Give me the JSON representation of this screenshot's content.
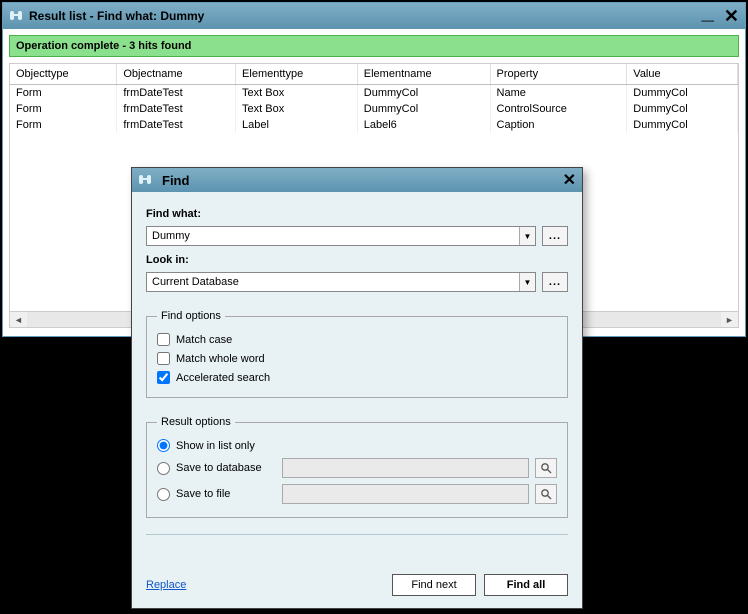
{
  "main_window": {
    "title": "Result list - Find what: Dummy",
    "status": "Operation complete - 3 hits found",
    "columns": [
      "Objecttype",
      "Objectname",
      "Elementtype",
      "Elementname",
      "Property",
      "Value"
    ],
    "rows": [
      {
        "objecttype": "Form",
        "objectname": "frmDateTest",
        "elementtype": "Text Box",
        "elementname": "DummyCol",
        "property": "Name",
        "value": "DummyCol"
      },
      {
        "objecttype": "Form",
        "objectname": "frmDateTest",
        "elementtype": "Text Box",
        "elementname": "DummyCol",
        "property": "ControlSource",
        "value": "DummyCol"
      },
      {
        "objecttype": "Form",
        "objectname": "frmDateTest",
        "elementtype": "Label",
        "elementname": "Label6",
        "property": "Caption",
        "value": "DummyCol"
      }
    ]
  },
  "find_dialog": {
    "title": "Find",
    "find_what_label": "Find what:",
    "find_what_value": "Dummy",
    "look_in_label": "Look in:",
    "look_in_value": "Current Database",
    "browse_label": "...",
    "find_options": {
      "legend": "Find options",
      "match_case": {
        "label": "Match case",
        "checked": false
      },
      "match_whole_word": {
        "label": "Match whole word",
        "checked": false
      },
      "accelerated": {
        "label": "Accelerated search",
        "checked": true
      }
    },
    "result_options": {
      "legend": "Result options",
      "show_list": "Show in list only",
      "save_db": "Save to database",
      "save_file": "Save to file",
      "selected": "show_list"
    },
    "replace_link": "Replace",
    "find_next": "Find next",
    "find_all": "Find all"
  }
}
